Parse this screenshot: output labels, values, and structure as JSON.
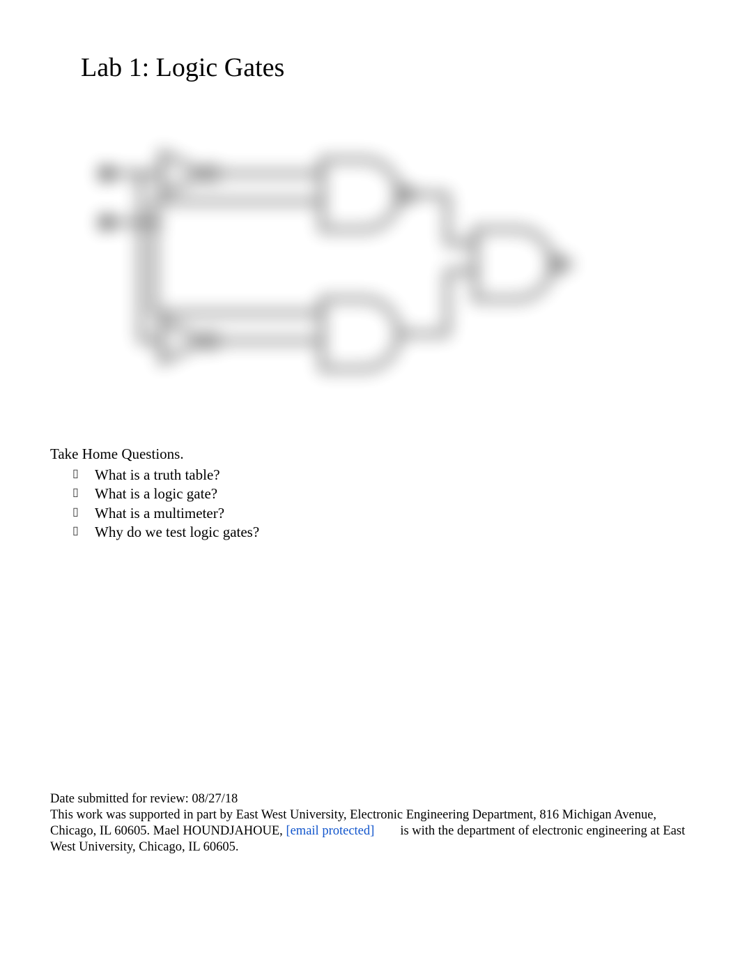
{
  "title": "Lab 1: Logic Gates",
  "section_heading": "Take Home Questions.",
  "questions": [
    "What is a truth table?",
    "What is a logic gate?",
    "What is a multimeter?",
    "Why do we test logic gates?"
  ],
  "footer": {
    "date_line": "Date submitted for review: 08/27/18",
    "support_prefix": "This work was supported in part by East West University, Electronic Engineering Department, 816 Michigan Avenue, Chicago, IL 60605. Mael HOUNDJAHOUE, ",
    "email": "[email protected]",
    "support_suffix": " is with the department of electronic engineering at East West University, Chicago, IL 60605."
  },
  "diagram": {
    "inputs": [
      "A",
      "B"
    ],
    "gates": [
      "NOT",
      "NOT",
      "NAND",
      "AND",
      "NAND"
    ],
    "output": "Y"
  }
}
